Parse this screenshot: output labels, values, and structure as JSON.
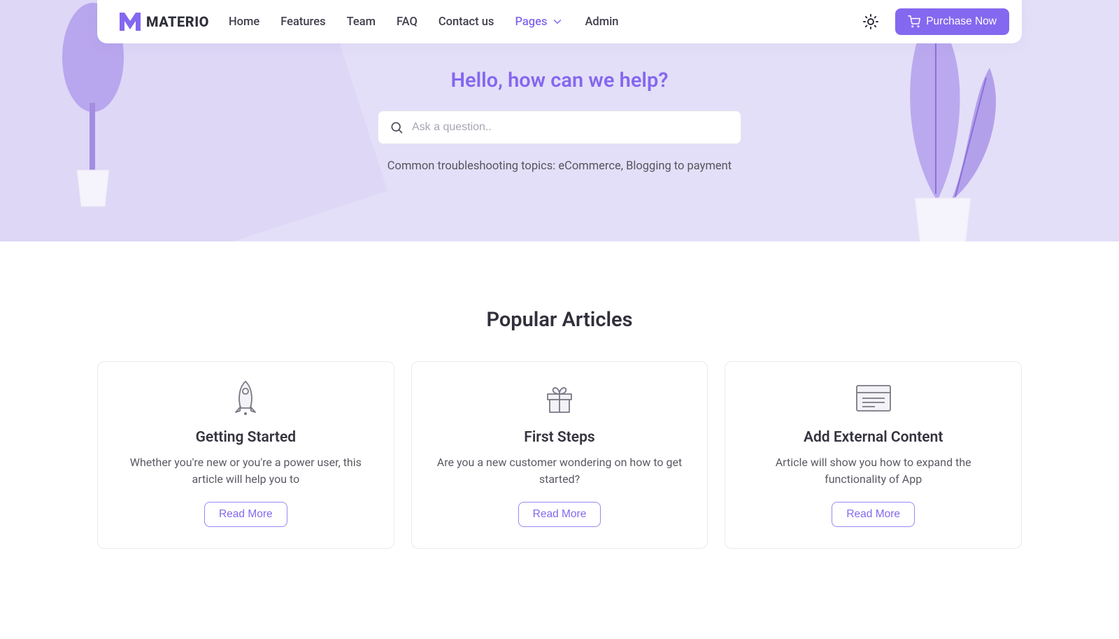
{
  "brand": {
    "name": "MATERIO"
  },
  "nav": {
    "items": [
      {
        "label": "Home"
      },
      {
        "label": "Features"
      },
      {
        "label": "Team"
      },
      {
        "label": "FAQ"
      },
      {
        "label": "Contact us"
      },
      {
        "label": "Pages"
      },
      {
        "label": "Admin"
      }
    ],
    "active_index": 5
  },
  "header": {
    "purchase_label": "Purchase Now"
  },
  "hero": {
    "title": "Hello, how can we help?",
    "search_placeholder": "Ask a question..",
    "subtext": "Common troubleshooting topics: eCommerce, Blogging to payment"
  },
  "articles": {
    "section_title": "Popular Articles",
    "cards": [
      {
        "icon": "rocket-icon",
        "title": "Getting Started",
        "desc": "Whether you're new or you're a power user, this article will help you to",
        "cta": "Read More"
      },
      {
        "icon": "gift-icon",
        "title": "First Steps",
        "desc": "Are you a new customer wondering on how to get started?",
        "cta": "Read More"
      },
      {
        "icon": "document-icon",
        "title": "Add External Content",
        "desc": "Article will show you how to expand the functionality of App",
        "cta": "Read More"
      }
    ]
  },
  "colors": {
    "accent": "#8468ef",
    "hero_bg": "#e4dff8"
  }
}
